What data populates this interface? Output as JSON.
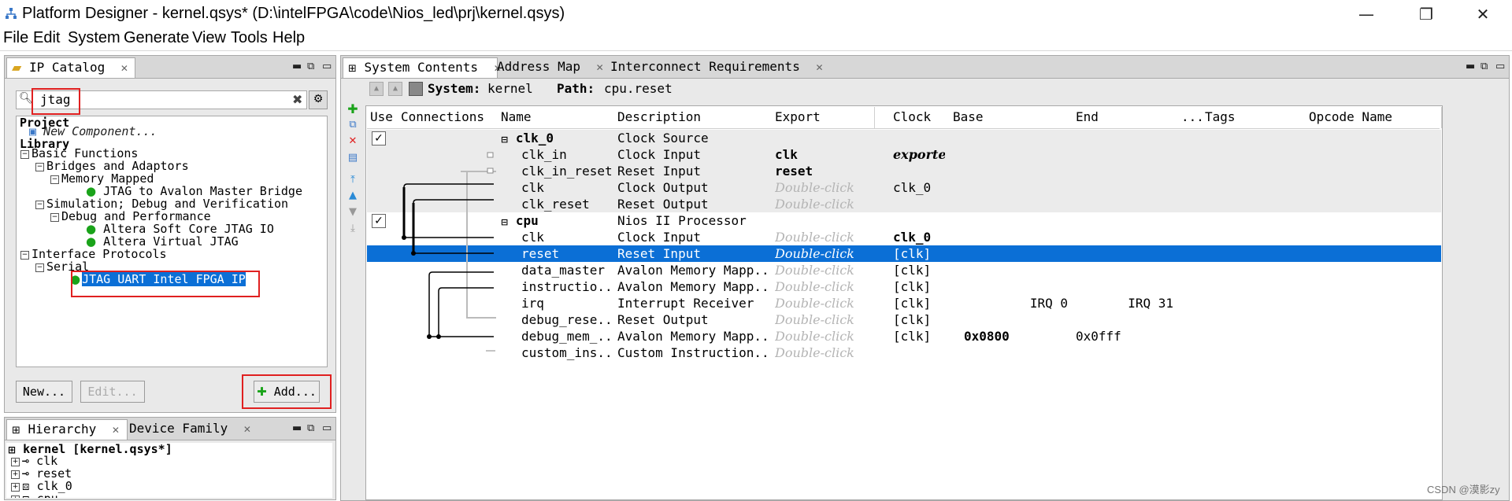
{
  "window": {
    "title": "Platform Designer - kernel.qsys* (D:\\intelFPGA\\code\\Nios_led\\prj\\kernel.qsys)",
    "minimize_icon": "minimize-icon",
    "maximize_icon": "restore-icon",
    "close_icon": "close-icon"
  },
  "menu": [
    "File",
    "Edit",
    "System",
    "Generate",
    "View",
    "Tools",
    "Help"
  ],
  "ip_catalog": {
    "tab_label": "IP Catalog",
    "search_value": "jtag",
    "tree": {
      "project": "Project",
      "new_component": "New Component...",
      "library": "Library",
      "basic_functions": "Basic Functions",
      "bridges": "Bridges and Adaptors",
      "memory_mapped": "Memory Mapped",
      "jtag_bridge": "JTAG to Avalon Master Bridge",
      "simulation": "Simulation; Debug and Verification",
      "debug_perf": "Debug and Performance",
      "soft_core_jtag": "Altera Soft Core JTAG IO",
      "virtual_jtag": "Altera Virtual JTAG",
      "interface_protocols": "Interface Protocols",
      "serial": "Serial",
      "jtag_uart": "JTAG UART Intel FPGA IP"
    },
    "new_button": "New...",
    "edit_button": "Edit...",
    "add_button": "Add..."
  },
  "hierarchy": {
    "tabs": [
      "Hierarchy",
      "Device Family"
    ],
    "items": [
      "kernel [kernel.qsys*]",
      "clk",
      "reset",
      "clk_0",
      "cpu"
    ]
  },
  "main_tabs": [
    "System Contents",
    "Address Map",
    "Interconnect Requirements"
  ],
  "system_bar": {
    "system_label": "System:",
    "system_value": "kernel",
    "path_label": "Path:",
    "path_value": "cpu.reset"
  },
  "table": {
    "columns": [
      "Use",
      "Connections",
      "Name",
      "Description",
      "Export",
      "Clock",
      "Base",
      "End",
      "...",
      "Tags",
      "Opcode Name"
    ],
    "rows": [
      {
        "use": true,
        "name": "clk_0",
        "desc": "Clock Source",
        "export": "",
        "clock": "",
        "base": "",
        "end": "",
        "group": true
      },
      {
        "name": "clk_in",
        "desc": "Clock Input",
        "export": "clk",
        "clock": "exporte",
        "base": "",
        "end": ""
      },
      {
        "name": "clk_in_reset",
        "desc": "Reset Input",
        "export": "reset",
        "clock": "",
        "base": "",
        "end": ""
      },
      {
        "name": "clk",
        "desc": "Clock Output",
        "export": "Double-click",
        "clock": "clk_0",
        "base": "",
        "end": ""
      },
      {
        "name": "clk_reset",
        "desc": "Reset Output",
        "export": "Double-click",
        "clock": "",
        "base": "",
        "end": ""
      },
      {
        "use": true,
        "name": "cpu",
        "desc": "Nios II Processor",
        "export": "",
        "clock": "",
        "base": "",
        "end": "",
        "group": true
      },
      {
        "name": "clk",
        "desc": "Clock Input",
        "export": "Double-click",
        "clock": "clk_0",
        "base": "",
        "end": ""
      },
      {
        "name": "reset",
        "desc": "Reset Input",
        "export": "Double-click",
        "clock": "[clk]",
        "base": "",
        "end": "",
        "selected": true
      },
      {
        "name": "data_master",
        "desc": "Avalon Memory Mapp...",
        "export": "Double-click",
        "clock": "[clk]",
        "base": "",
        "end": ""
      },
      {
        "name": "instructio...",
        "desc": "Avalon Memory Mapp...",
        "export": "Double-click",
        "clock": "[clk]",
        "base": "",
        "end": ""
      },
      {
        "name": "irq",
        "desc": "Interrupt Receiver",
        "export": "Double-click",
        "clock": "[clk]",
        "base": "IRQ 0",
        "end": "IRQ 31"
      },
      {
        "name": "debug_rese...",
        "desc": "Reset Output",
        "export": "Double-click",
        "clock": "[clk]",
        "base": "",
        "end": ""
      },
      {
        "name": "debug_mem_...",
        "desc": "Avalon Memory Mapp...",
        "export": "Double-click",
        "clock": "[clk]",
        "base": "0x0800",
        "end": "0x0fff"
      },
      {
        "name": "custom_ins...",
        "desc": "Custom Instruction...",
        "export": "Double-click",
        "clock": "",
        "base": "",
        "end": ""
      }
    ]
  },
  "watermark": "CSDN @漠影zy",
  "colors": {
    "selection": "#0b6fd6",
    "highlight_box": "#e02020",
    "plus_green": "#1aa31a",
    "remove_red": "#e02020"
  }
}
